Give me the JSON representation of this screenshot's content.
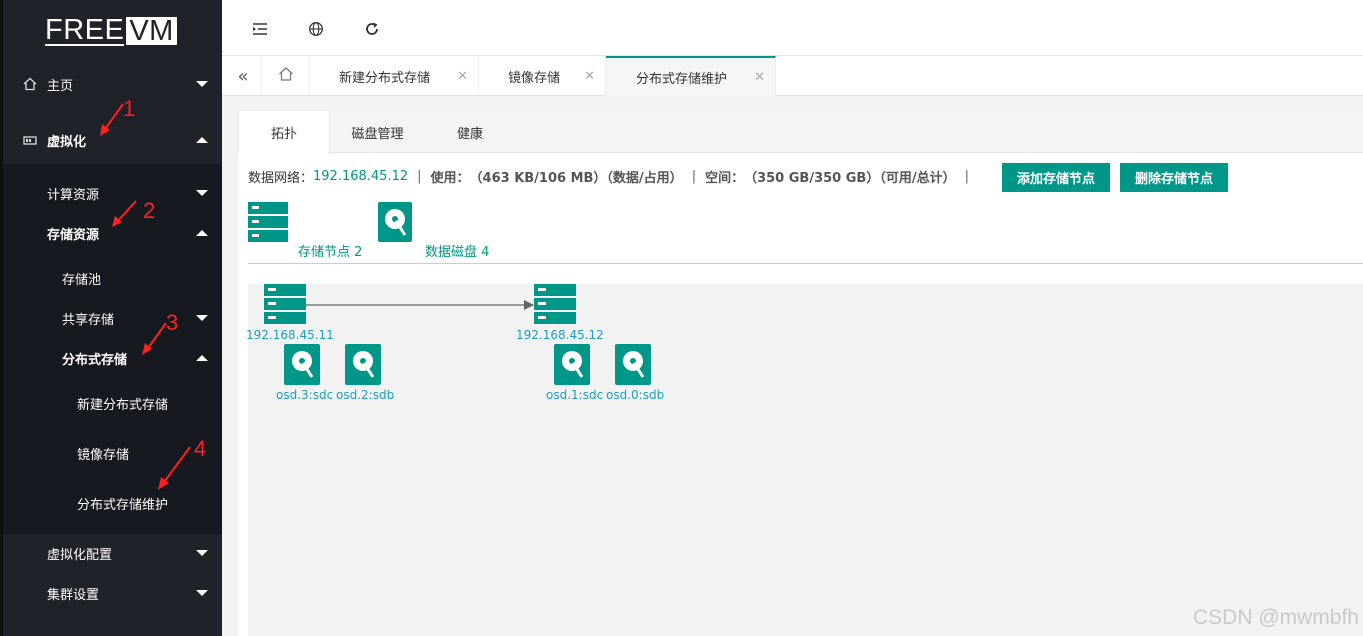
{
  "logo": {
    "free": "FREE",
    "vm": "VM"
  },
  "sidebar": {
    "items": [
      {
        "label": "主页"
      },
      {
        "label": "虚拟化"
      },
      {
        "label": "计算资源"
      },
      {
        "label": "存储资源"
      },
      {
        "label": "存储池"
      },
      {
        "label": "共享存储"
      },
      {
        "label": "分布式存储"
      },
      {
        "label": "新建分布式存储"
      },
      {
        "label": "镜像存储"
      },
      {
        "label": "分布式存储维护"
      },
      {
        "label": "虚拟化配置"
      },
      {
        "label": "集群设置"
      }
    ]
  },
  "annotations": [
    "1",
    "2",
    "3",
    "4"
  ],
  "tabs": [
    {
      "label": "新建分布式存储"
    },
    {
      "label": "镜像存储"
    },
    {
      "label": "分布式存储维护"
    }
  ],
  "content_tabs": [
    {
      "label": "拓扑"
    },
    {
      "label": "磁盘管理"
    },
    {
      "label": "健康"
    }
  ],
  "info": {
    "network_label": "数据网络：",
    "network_value": "192.168.45.12",
    "usage_label": "使用：",
    "usage_value": "（463 KB/106 MB）（数据/占用）",
    "space_label": "空间：",
    "space_value": "（350 GB/350 GB）（可用/总计）",
    "separator": "|"
  },
  "buttons": {
    "add_node": "添加存储节点",
    "delete_node": "删除存储节点"
  },
  "legend": {
    "nodes": "存储节点 2",
    "disks": "数据磁盘 4"
  },
  "topology": {
    "hosts": [
      {
        "ip": "192.168.45.11",
        "disks": [
          "osd.3:sdc",
          "osd.2:sdb"
        ]
      },
      {
        "ip": "192.168.45.12",
        "disks": [
          "osd.1:sdc",
          "osd.0:sdb"
        ]
      }
    ]
  },
  "colors": {
    "accent": "#009688",
    "sidebar": "#20222a",
    "annotation": "#ff2020",
    "node_label": "#1e9fbf"
  },
  "watermark": "CSDN @mwmbfh"
}
